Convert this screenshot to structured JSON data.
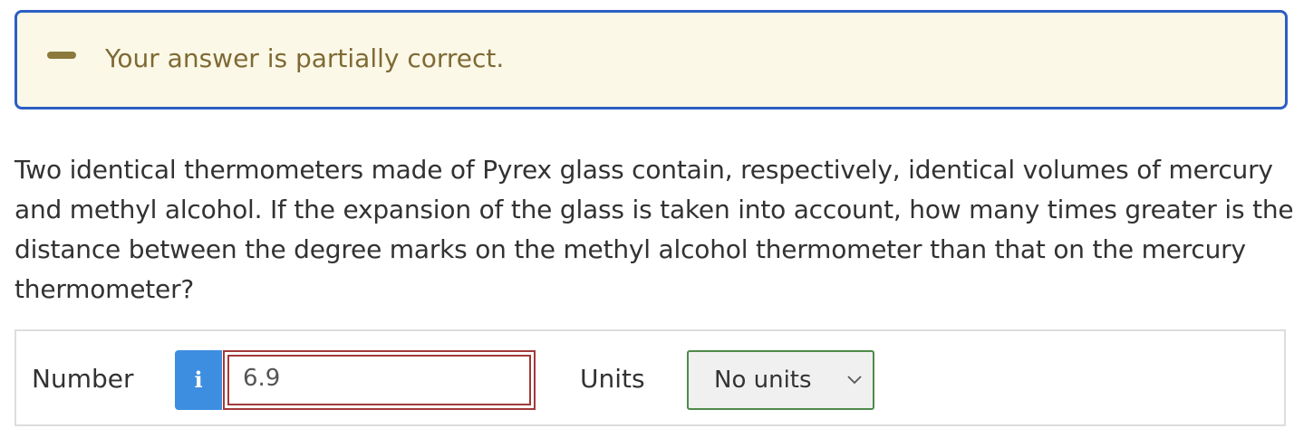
{
  "feedback": {
    "icon": "minus-icon",
    "message": "Your answer is partially correct.",
    "accent_color": "#2d5fc3",
    "background_color": "#fbf8e7"
  },
  "question": {
    "lines": [
      "Two identical thermometers made of Pyrex glass contain, respectively, identical volumes of mercury",
      "and methyl alcohol. If the expansion of the glass is taken into account, how many times greater is the",
      "distance between the degree marks on the methyl alcohol thermometer than that on the mercury",
      "thermometer?"
    ]
  },
  "answer": {
    "number_label": "Number",
    "info_icon": "info-icon",
    "info_glyph": "i",
    "number_value": "6.9",
    "number_status_color": "#a23a38",
    "units_label": "Units",
    "units_selected": "No units",
    "units_status_color": "#4e8a4a"
  }
}
